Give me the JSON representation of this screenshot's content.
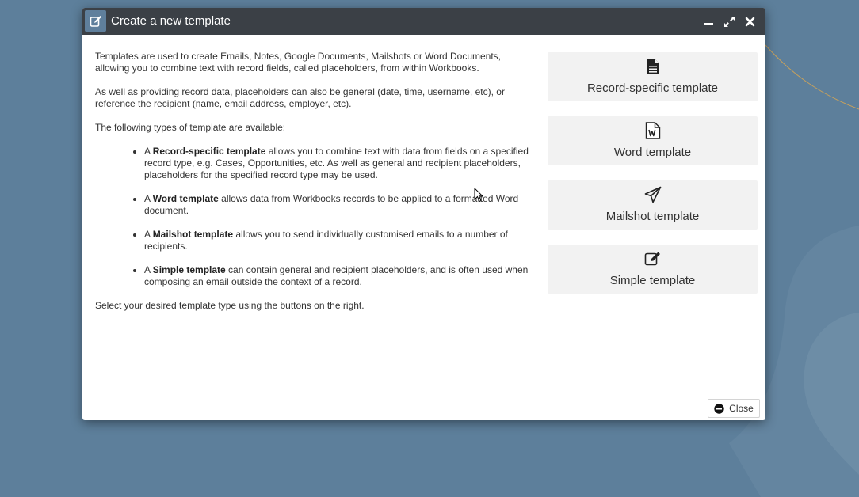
{
  "dialog": {
    "title": "Create a new template",
    "icons": {
      "title": "edit-icon",
      "minimize": "minimize-icon",
      "maximize": "expand-icon",
      "close": "close-icon"
    }
  },
  "intro": {
    "p1": "Templates are used to create Emails, Notes, Google Documents, Mailshots or Word Documents, allowing you to combine text with record fields, called placeholders, from within Workbooks.",
    "p2": "As well as providing record data, placeholders can also be general (date, time, username, etc), or reference the recipient (name, email address, employer, etc).",
    "p3": "The following types of template are available:"
  },
  "types": [
    {
      "prefix": "A ",
      "name": "Record-specific template",
      "desc": " allows you to combine text with data from fields on a specified record type, e.g. Cases, Opportunities, etc. As well as general and recipient placeholders, placeholders for the specified record type may be used."
    },
    {
      "prefix": "A ",
      "name": "Word template",
      "desc": " allows data from Workbooks records to be applied to a formatted Word document."
    },
    {
      "prefix": "A ",
      "name": "Mailshot template",
      "desc": " allows you to send individually customised emails to a number of recipients."
    },
    {
      "prefix": "A ",
      "name": "Simple template",
      "desc": " can contain general and recipient placeholders, and is often used when composing an email outside the context of a record."
    }
  ],
  "outro": "Select your desired template type using the buttons on the right.",
  "buttons": [
    {
      "label": "Record-specific template",
      "icon": "document-icon"
    },
    {
      "label": "Word template",
      "icon": "word-document-icon"
    },
    {
      "label": "Mailshot template",
      "icon": "paper-plane-icon"
    },
    {
      "label": "Simple template",
      "icon": "edit-icon"
    }
  ],
  "footer": {
    "close_label": "Close",
    "close_icon": "minus-circle-icon"
  },
  "colors": {
    "background": "#5d7f9b",
    "titlebar": "#3b4046",
    "title_icon_box": "#5f7f9c",
    "button_bg": "#f2f2f2",
    "text": "#333333"
  }
}
